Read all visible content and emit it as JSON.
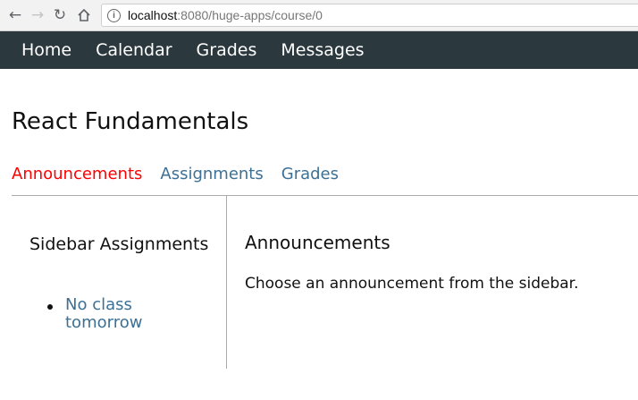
{
  "browser": {
    "url_host": "localhost",
    "url_rest": ":8080/huge-apps/course/0",
    "back_icon": "back-arrow-icon",
    "forward_icon": "forward-arrow-icon",
    "reload_icon": "reload-icon",
    "home_icon": "home-icon",
    "info_icon": "info-icon"
  },
  "nav": {
    "items": [
      {
        "label": "Home"
      },
      {
        "label": "Calendar"
      },
      {
        "label": "Grades"
      },
      {
        "label": "Messages"
      }
    ]
  },
  "course": {
    "title": "React Fundamentals",
    "tabs": [
      {
        "label": "Announcements",
        "active": true
      },
      {
        "label": "Assignments",
        "active": false
      },
      {
        "label": "Grades",
        "active": false
      }
    ]
  },
  "sidebar": {
    "heading": "Sidebar Assignments",
    "items": [
      {
        "label": "No class tomorrow"
      }
    ]
  },
  "main": {
    "heading": "Announcements",
    "text": "Choose an announcement from the sidebar."
  },
  "colors": {
    "nav_bg": "#2b383e",
    "nav_text": "#ffffff",
    "active_tab": "#ff0000",
    "link": "#3d7095"
  }
}
